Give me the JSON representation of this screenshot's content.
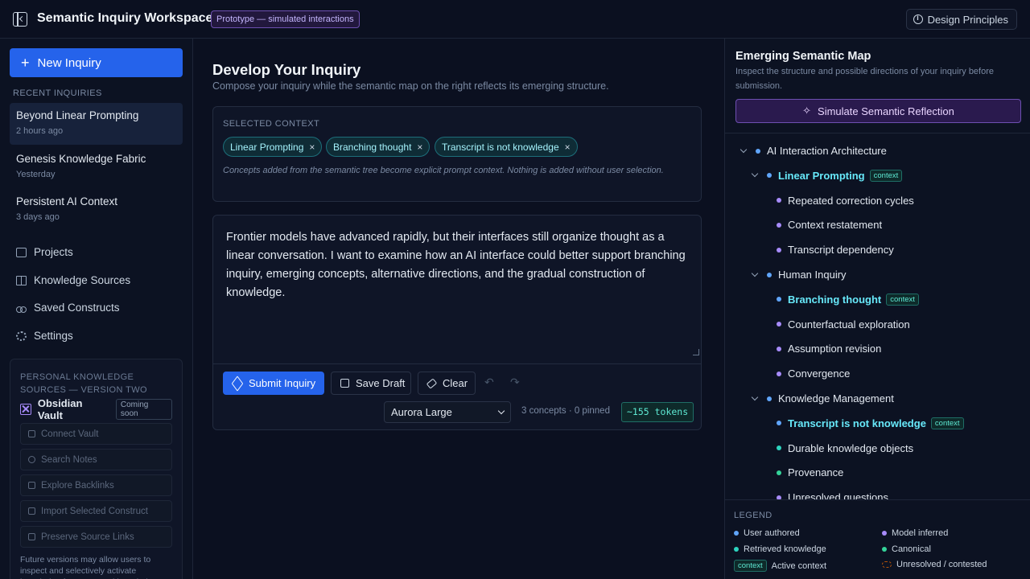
{
  "app": {
    "title": "Semantic Inquiry Workspace",
    "badge": "Prototype — simulated interactions",
    "design_principles": "Design Principles"
  },
  "sidebar": {
    "new_inquiry": "New Inquiry",
    "recent_label": "RECENT INQUIRIES",
    "recent": [
      {
        "title": "Beyond Linear Prompting",
        "time": "2 hours ago"
      },
      {
        "title": "Genesis Knowledge Fabric",
        "time": "Yesterday"
      },
      {
        "title": "Persistent AI Context",
        "time": "3 days ago"
      }
    ],
    "nav": [
      {
        "label": "Projects",
        "icon": "folder-icon"
      },
      {
        "label": "Knowledge Sources",
        "icon": "book-icon"
      },
      {
        "label": "Saved Constructs",
        "icon": "layers-icon"
      },
      {
        "label": "Settings",
        "icon": "gear-icon"
      }
    ],
    "pks": {
      "label": "PERSONAL KNOWLEDGE SOURCES — VERSION TWO",
      "vault": "Obsidian Vault",
      "soon": "Coming soon",
      "buttons": [
        "Connect Vault",
        "Search Notes",
        "Explore Backlinks",
        "Import Selected Construct",
        "Preserve Source Links"
      ],
      "note": "Future versions may allow users to inspect and selectively activate knowledge from personal knowledge"
    }
  },
  "main": {
    "title": "Develop Your Inquiry",
    "subtitle": "Compose your inquiry while the semantic map on the right reflects its emerging structure.",
    "context_label": "SELECTED CONTEXT",
    "chips": [
      "Linear Prompting",
      "Branching thought",
      "Transcript is not knowledge"
    ],
    "chip_remove": "×",
    "context_note": "Concepts added from the semantic tree become explicit prompt context. Nothing is added without user selection.",
    "editor_text": "Frontier models have advanced rapidly, but their interfaces still organize thought as a linear conversation. I want to examine how an AI interface could better support branching inquiry, emerging concepts, alternative directions, and the gradual construction of knowledge.",
    "submit": "Submit Inquiry",
    "save_draft": "Save Draft",
    "clear": "Clear",
    "undo": "↶",
    "redo": "↷",
    "model": "Aurora Large",
    "counts": "3 concepts · 0 pinned",
    "tokens": "~155 tokens"
  },
  "panel": {
    "title": "Emerging Semantic Map",
    "subtitle": "Inspect the structure and possible directions of your inquiry before submission.",
    "simulate": "Simulate Semantic Reflection",
    "context_tag": "context",
    "tree": [
      {
        "label": "AI Interaction Architecture",
        "level": 0,
        "caret": true,
        "dot": "#60a5fa",
        "active": false
      },
      {
        "label": "Linear Prompting",
        "level": 1,
        "caret": true,
        "dot": "#60a5fa",
        "active": true
      },
      {
        "label": "Repeated correction cycles",
        "level": 2,
        "caret": false,
        "dot": "#a78bfa",
        "active": false
      },
      {
        "label": "Context restatement",
        "level": 2,
        "caret": false,
        "dot": "#a78bfa",
        "active": false
      },
      {
        "label": "Transcript dependency",
        "level": 2,
        "caret": false,
        "dot": "#a78bfa",
        "active": false
      },
      {
        "label": "Human Inquiry",
        "level": 1,
        "caret": true,
        "dot": "#60a5fa",
        "active": false
      },
      {
        "label": "Branching thought",
        "level": 2,
        "caret": false,
        "dot": "#60a5fa",
        "active": true
      },
      {
        "label": "Counterfactual exploration",
        "level": 2,
        "caret": false,
        "dot": "#a78bfa",
        "active": false
      },
      {
        "label": "Assumption revision",
        "level": 2,
        "caret": false,
        "dot": "#a78bfa",
        "active": false
      },
      {
        "label": "Convergence",
        "level": 2,
        "caret": false,
        "dot": "#a78bfa",
        "active": false
      },
      {
        "label": "Knowledge Management",
        "level": 1,
        "caret": true,
        "dot": "#60a5fa",
        "active": false
      },
      {
        "label": "Transcript is not knowledge",
        "level": 2,
        "caret": false,
        "dot": "#60a5fa",
        "active": true
      },
      {
        "label": "Durable knowledge objects",
        "level": 2,
        "caret": false,
        "dot": "#2dd4bf",
        "active": false
      },
      {
        "label": "Provenance",
        "level": 2,
        "caret": false,
        "dot": "#34d399",
        "active": false
      },
      {
        "label": "Unresolved questions",
        "level": 2,
        "caret": false,
        "dot": "#a78bfa",
        "active": false
      }
    ],
    "legend_label": "LEGEND",
    "legend": {
      "user_authored": "User authored",
      "model_inferred": "Model inferred",
      "retrieved": "Retrieved knowledge",
      "canonical": "Canonical",
      "context_tag": "context",
      "active_context": "Active context",
      "unresolved": "Unresolved / contested"
    },
    "colors": {
      "user_authored": "#60a5fa",
      "model_inferred": "#a78bfa",
      "retrieved": "#2dd4bf",
      "canonical": "#34d399"
    }
  }
}
